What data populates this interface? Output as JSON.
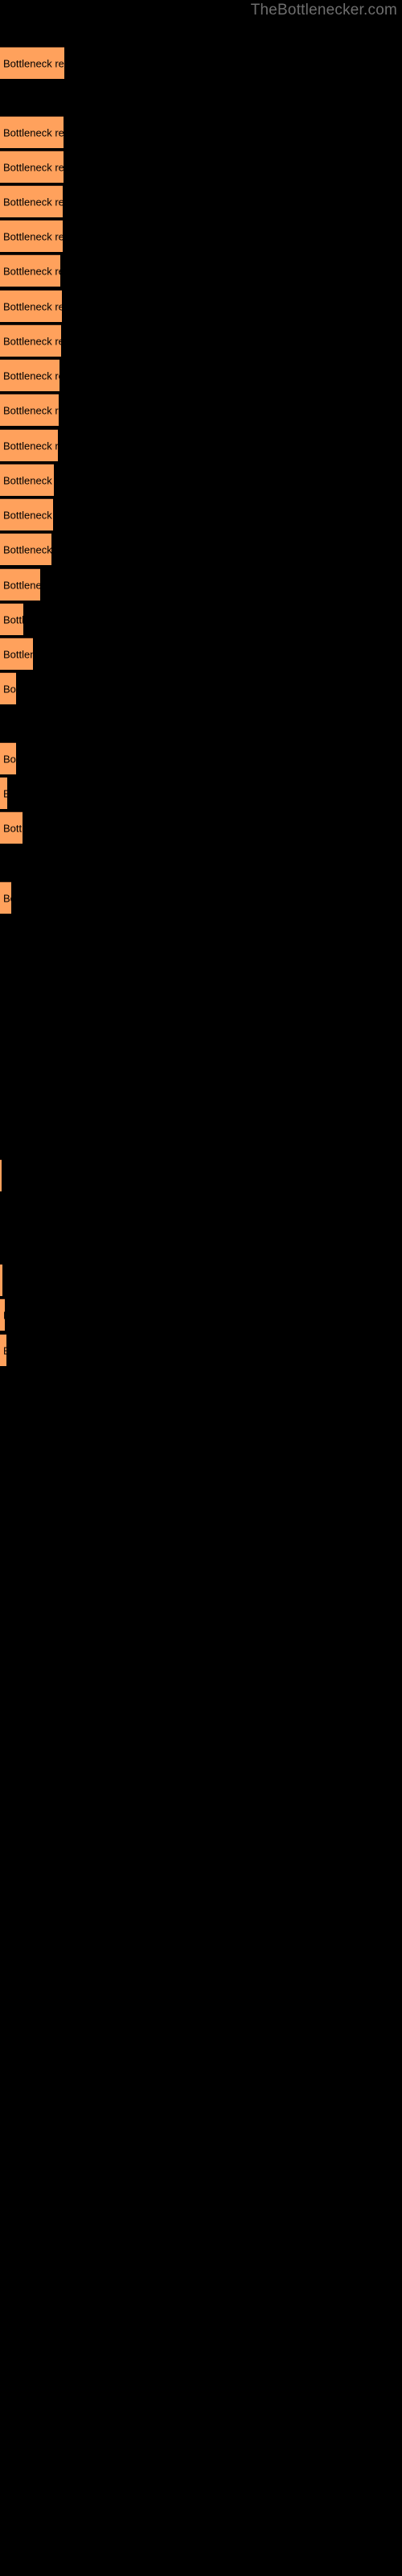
{
  "watermark": "TheBottlenecker.com",
  "colors": {
    "background": "#000000",
    "bar_fill": "#ffa15c",
    "bar_border": "#3a2012",
    "label_text": "#000000",
    "watermark_text": "#6e6e6e"
  },
  "chart_data": {
    "type": "bar",
    "orientation": "horizontal",
    "title": "",
    "subtitle": "",
    "xlabel": "",
    "ylabel": "",
    "grid": false,
    "legend": null,
    "axis_visible": false,
    "tick_labels": [],
    "bar_label_text": "Bottleneck result",
    "xlim": [
      0,
      80
    ],
    "categories": [
      "bar-1",
      "bar-2",
      "bar-3",
      "bar-4",
      "bar-5",
      "bar-6",
      "bar-7",
      "bar-8",
      "bar-9",
      "bar-10",
      "bar-11",
      "bar-12",
      "bar-13",
      "bar-14",
      "bar-15",
      "bar-16",
      "bar-17",
      "bar-18",
      "bar-19",
      "bar-20",
      "bar-21",
      "bar-22",
      "bar-23",
      "bar-24",
      "bar-25",
      "bar-26",
      "bar-27",
      "bar-28",
      "bar-29",
      "bar-30",
      "bar-31",
      "bar-32",
      "bar-33",
      "bar-34",
      "bar-35",
      "bar-36",
      "bar-37",
      "bar-38",
      "bar-39",
      "bar-40",
      "bar-41",
      "bar-42",
      "bar-43",
      "bar-44",
      "bar-45",
      "bar-46",
      "bar-47",
      "bar-48",
      "bar-49",
      "bar-50",
      "bar-51",
      "bar-52",
      "bar-53",
      "bar-54",
      "bar-55",
      "bar-56",
      "bar-57",
      "bar-58",
      "bar-59",
      "bar-60",
      "bar-61",
      "bar-62",
      "bar-63",
      "bar-64",
      "bar-65",
      "bar-66",
      "bar-67",
      "bar-68",
      "bar-69",
      "bar-70",
      "bar-71",
      "bar-72"
    ],
    "values": [
      80,
      79,
      79,
      78,
      78,
      75,
      77,
      76,
      74,
      73,
      72,
      67,
      66,
      64,
      50,
      29,
      41,
      20,
      0,
      20,
      9,
      28,
      0,
      14,
      0,
      0,
      0,
      0,
      0,
      0,
      0,
      0,
      0,
      0,
      0,
      0,
      0,
      0,
      0,
      0,
      0,
      0,
      0,
      0,
      0,
      0,
      0,
      0,
      0,
      0,
      0,
      0,
      0,
      0,
      0,
      0,
      0,
      0,
      0,
      0,
      0,
      0,
      2,
      0,
      0,
      0,
      3,
      0,
      6,
      0,
      8,
      0
    ],
    "bars": [
      {
        "index": 1,
        "y": 58,
        "width": 80,
        "height": 40,
        "label": "Bottleneck result"
      },
      {
        "index": 2,
        "y": 144,
        "width": 79,
        "height": 40,
        "label": "Bottleneck result"
      },
      {
        "index": 3,
        "y": 187,
        "width": 79,
        "height": 40,
        "label": "Bottleneck result"
      },
      {
        "index": 4,
        "y": 230,
        "width": 78,
        "height": 40,
        "label": "Bottleneck result"
      },
      {
        "index": 5,
        "y": 273,
        "width": 78,
        "height": 40,
        "label": "Bottleneck result"
      },
      {
        "index": 6,
        "y": 316,
        "width": 75,
        "height": 40,
        "label": "Bottleneck result"
      },
      {
        "index": 7,
        "y": 360,
        "width": 77,
        "height": 40,
        "label": "Bottleneck result"
      },
      {
        "index": 8,
        "y": 403,
        "width": 76,
        "height": 40,
        "label": "Bottleneck result"
      },
      {
        "index": 9,
        "y": 446,
        "width": 74,
        "height": 40,
        "label": "Bottleneck result"
      },
      {
        "index": 10,
        "y": 489,
        "width": 73,
        "height": 40,
        "label": "Bottleneck result"
      },
      {
        "index": 11,
        "y": 533,
        "width": 72,
        "height": 40,
        "label": "Bottleneck result"
      },
      {
        "index": 12,
        "y": 576,
        "width": 67,
        "height": 40,
        "label": "Bottleneck result"
      },
      {
        "index": 13,
        "y": 619,
        "width": 66,
        "height": 40,
        "label": "Bottleneck result"
      },
      {
        "index": 14,
        "y": 662,
        "width": 64,
        "height": 40,
        "label": "Bottleneck result"
      },
      {
        "index": 15,
        "y": 706,
        "width": 50,
        "height": 40,
        "label": "Bottleneck result"
      },
      {
        "index": 16,
        "y": 749,
        "width": 29,
        "height": 40,
        "label": "Bottleneck result"
      },
      {
        "index": 17,
        "y": 792,
        "width": 41,
        "height": 40,
        "label": "Bottleneck result"
      },
      {
        "index": 18,
        "y": 835,
        "width": 20,
        "height": 40,
        "label": "Bottleneck result"
      },
      {
        "index": 19,
        "y": 922,
        "width": 20,
        "height": 40,
        "label": "Bottleneck result"
      },
      {
        "index": 20,
        "y": 965,
        "width": 9,
        "height": 40,
        "label": "Bottleneck result"
      },
      {
        "index": 21,
        "y": 1008,
        "width": 28,
        "height": 40,
        "label": "Bottleneck result"
      },
      {
        "index": 22,
        "y": 1095,
        "width": 14,
        "height": 40,
        "label": "Bottleneck result"
      },
      {
        "index": 23,
        "y": 1440,
        "width": 2,
        "height": 40,
        "label": "Bottleneck result"
      },
      {
        "index": 24,
        "y": 1570,
        "width": 3,
        "height": 40,
        "label": "Bottleneck result"
      },
      {
        "index": 25,
        "y": 1613,
        "width": 6,
        "height": 40,
        "label": "Bottleneck result"
      },
      {
        "index": 26,
        "y": 1657,
        "width": 8,
        "height": 40,
        "label": "Bottleneck result"
      }
    ]
  }
}
